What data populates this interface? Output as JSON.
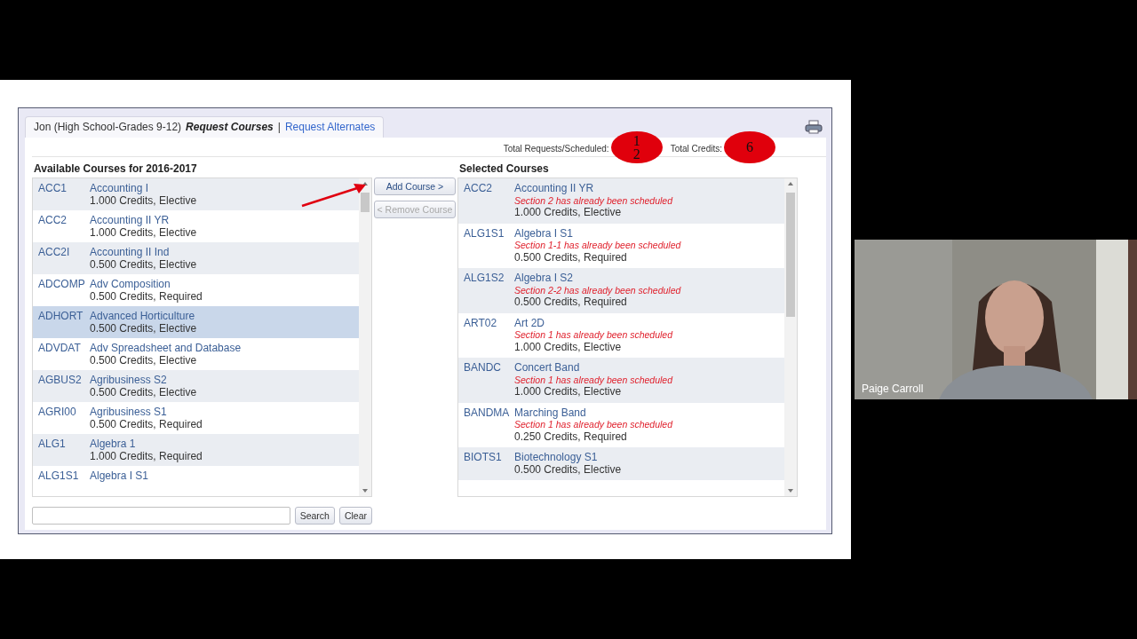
{
  "header": {
    "student": "Jon (High School-Grades 9-12)",
    "separator": "|",
    "tabs": [
      {
        "label": "Request Courses",
        "selected": true
      },
      {
        "label": "Request Alternates",
        "selected": false
      }
    ]
  },
  "totals": {
    "requests_label": "Total Requests/Scheduled:",
    "requests": "1",
    "scheduled": "2",
    "credits_label": "Total Credits:",
    "credits": "6"
  },
  "available": {
    "title": "Available Courses for 2016-2017",
    "courses": [
      {
        "code": "ACC1",
        "name": "Accounting I",
        "details": "1.000 Credits,  Elective",
        "selected": false
      },
      {
        "code": "ACC2",
        "name": "Accounting II YR",
        "details": "1.000 Credits,  Elective",
        "selected": false
      },
      {
        "code": "ACC2I",
        "name": "Accounting II Ind",
        "details": "0.500 Credits,  Elective",
        "selected": false
      },
      {
        "code": "ADCOMP",
        "name": "Adv Composition",
        "details": "0.500 Credits,  Required",
        "selected": false
      },
      {
        "code": "ADHORT",
        "name": "Advanced Horticulture",
        "details": "0.500 Credits,  Elective",
        "selected": true
      },
      {
        "code": "ADVDAT",
        "name": "Adv Spreadsheet and Database",
        "details": "0.500 Credits,  Elective",
        "selected": false
      },
      {
        "code": "AGBUS2",
        "name": "Agribusiness S2",
        "details": "0.500 Credits,  Elective",
        "selected": false
      },
      {
        "code": "AGRI00",
        "name": "Agribusiness S1",
        "details": "0.500 Credits,  Required",
        "selected": false
      },
      {
        "code": "ALG1",
        "name": "Algebra 1",
        "details": "1.000 Credits,  Required",
        "selected": false
      },
      {
        "code": "ALG1S1",
        "name": "Algebra I S1",
        "selected": false
      }
    ]
  },
  "actions": [
    {
      "label": "Add Course >",
      "disabled": false
    },
    {
      "label": "< Remove Course",
      "disabled": true
    }
  ],
  "search": {
    "buttons": [
      "Search",
      "Clear"
    ]
  },
  "selected_courses": {
    "title": "Selected Courses",
    "courses": [
      {
        "code": "ACC2",
        "name": "Accounting II YR",
        "note": "Section 2 has already been scheduled",
        "details": "1.000 Credits,  Elective"
      },
      {
        "code": "ALG1S1",
        "name": "Algebra I S1",
        "note": "Section 1-1 has already been scheduled",
        "details": "0.500 Credits,  Required"
      },
      {
        "code": "ALG1S2",
        "name": "Algebra I S2",
        "note": "Section 2-2 has already been scheduled",
        "details": "0.500 Credits,  Required"
      },
      {
        "code": "ART02",
        "name": "Art 2D",
        "note": "Section 1 has already been scheduled",
        "details": "1.000 Credits,  Elective"
      },
      {
        "code": "BANDC",
        "name": "Concert Band",
        "note": "Section 1 has already been scheduled",
        "details": "1.000 Credits,  Elective"
      },
      {
        "code": "BANDMA",
        "name": "Marching Band",
        "note": "Section 1 has already been scheduled",
        "details": "0.250 Credits,  Required"
      },
      {
        "code": "BIOTS1",
        "name": "Biotechnology S1",
        "details": "0.500 Credits,  Elective"
      }
    ]
  },
  "video": {
    "kind": "picture",
    "participant": "Paige Carroll"
  }
}
